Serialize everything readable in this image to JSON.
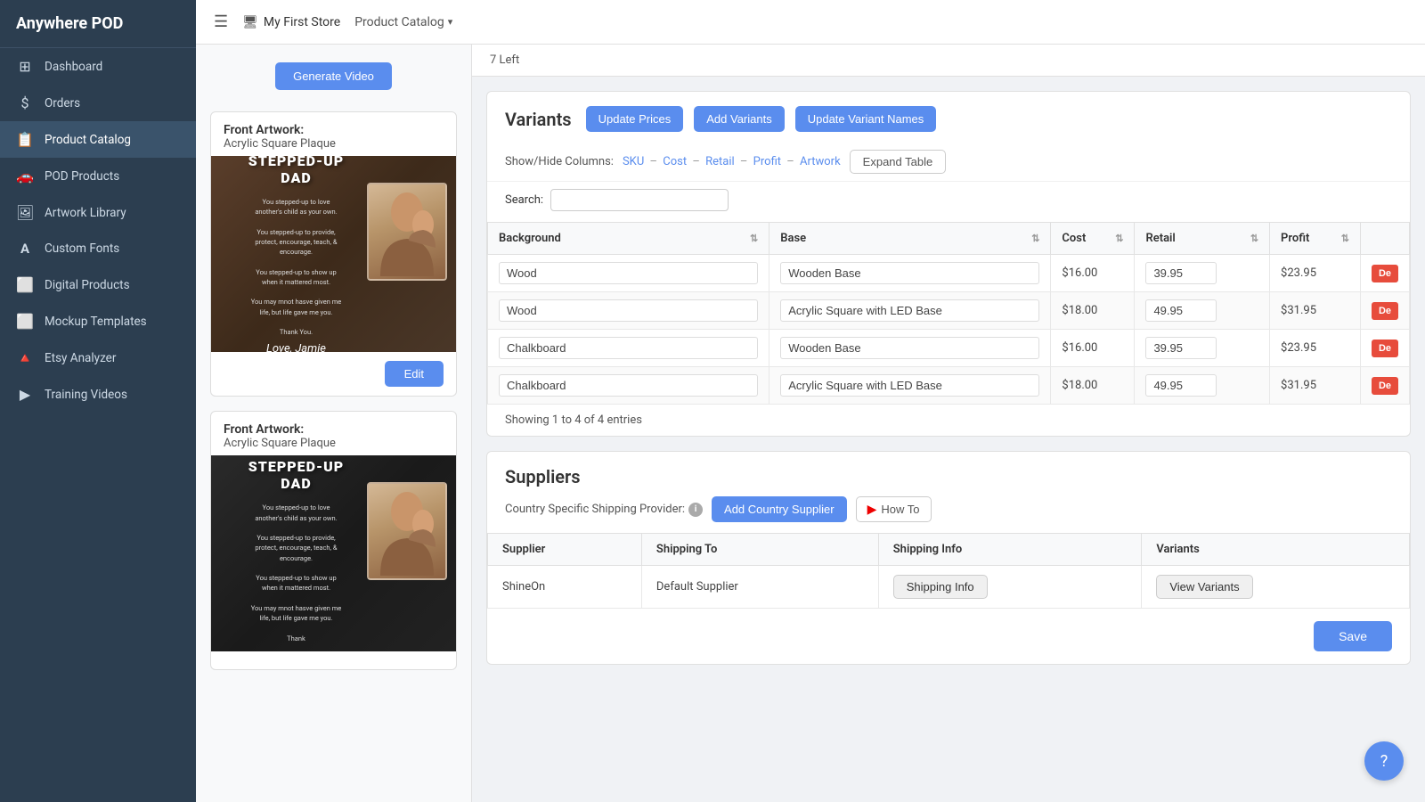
{
  "app": {
    "name": "Anywhere POD"
  },
  "topnav": {
    "store": "My First Store",
    "breadcrumb": "Product Catalog",
    "breadcrumb_caret": "▾"
  },
  "sidebar": {
    "items": [
      {
        "id": "dashboard",
        "label": "Dashboard",
        "icon": "⊞"
      },
      {
        "id": "orders",
        "label": "Orders",
        "icon": "$"
      },
      {
        "id": "product-catalog",
        "label": "Product Catalog",
        "icon": "📋",
        "active": true
      },
      {
        "id": "pod-products",
        "label": "POD Products",
        "icon": "🚗"
      },
      {
        "id": "artwork-library",
        "label": "Artwork Library",
        "icon": "🖼"
      },
      {
        "id": "custom-fonts",
        "label": "Custom Fonts",
        "icon": "A"
      },
      {
        "id": "digital-products",
        "label": "Digital Products",
        "icon": "⬜"
      },
      {
        "id": "mockup-templates",
        "label": "Mockup Templates",
        "icon": "⬜"
      },
      {
        "id": "etsy-analyzer",
        "label": "Etsy Analyzer",
        "icon": "🔺"
      },
      {
        "id": "training-videos",
        "label": "Training Videos",
        "icon": "▶"
      }
    ]
  },
  "left_panel": {
    "generate_btn": "Generate Video",
    "artworks": [
      {
        "id": "artwork-1",
        "title": "Front Artwork:",
        "subtitle": "Acrylic Square Plaque",
        "theme": "wood",
        "main_text": "STEPPED-UP DAD",
        "body_lines": [
          "You stepped-up to love another's",
          "child as your own.",
          "",
          "You stepped-up to provide, protect,",
          "encourage, teach, & encourage.",
          "",
          "You stepped-up to show up when it",
          "mattered most.",
          "",
          "You may mnot hasve given me life,",
          "but life gave me you.",
          "",
          "Thank You."
        ],
        "signature": "Love, Jamie",
        "edit_btn": "Edit"
      },
      {
        "id": "artwork-2",
        "title": "Front Artwork:",
        "subtitle": "Acrylic Square Plaque",
        "theme": "chalkboard",
        "main_text": "STEPPED-UP DAD",
        "body_lines": [
          "You stepped-up to love another's",
          "child as your own.",
          "",
          "You stepped-up to provide, protect,",
          "encourage, teach, & encourage.",
          "",
          "You stepped-up to show up when it",
          "mattered most.",
          "",
          "You may mnot hasve given me life,",
          "but life gave me you.",
          "",
          "Thank"
        ],
        "signature": "",
        "edit_btn": "Edit"
      }
    ]
  },
  "info_bar": {
    "left_text": "7 Left"
  },
  "variants": {
    "section_title": "Variants",
    "update_prices_btn": "Update Prices",
    "add_variants_btn": "Add Variants",
    "update_variant_names_btn": "Update Variant Names",
    "show_hide_label": "Show/Hide Columns:",
    "columns": [
      "SKU",
      "Cost",
      "Retail",
      "Profit",
      "Artwork"
    ],
    "separator": "–",
    "expand_table_btn": "Expand Table",
    "search_label": "Search:",
    "search_placeholder": "",
    "table_headers": [
      {
        "id": "background",
        "label": "Background",
        "sortable": true
      },
      {
        "id": "base",
        "label": "Base",
        "sortable": true
      },
      {
        "id": "cost",
        "label": "Cost",
        "sortable": true
      },
      {
        "id": "retail",
        "label": "Retail",
        "sortable": true
      },
      {
        "id": "profit",
        "label": "Profit",
        "sortable": true
      }
    ],
    "rows": [
      {
        "background": "Wood",
        "base": "Wooden Base",
        "cost": "$16.00",
        "retail": "39.95",
        "profit": "$23.95",
        "action": "De"
      },
      {
        "background": "Wood",
        "base": "Acrylic Square with LED Base",
        "cost": "$18.00",
        "retail": "49.95",
        "profit": "$31.95",
        "action": "De"
      },
      {
        "background": "Chalkboard",
        "base": "Wooden Base",
        "cost": "$16.00",
        "retail": "39.95",
        "profit": "$23.95",
        "action": "De"
      },
      {
        "background": "Chalkboard",
        "base": "Acrylic Square with LED Base",
        "cost": "$18.00",
        "retail": "49.95",
        "profit": "$31.95",
        "action": "De"
      }
    ],
    "showing_text": "Showing 1 to 4 of 4 entries"
  },
  "suppliers": {
    "section_title": "Suppliers",
    "country_label": "Country Specific Shipping Provider:",
    "add_country_btn": "Add Country Supplier",
    "how_to_btn": "How To",
    "table_headers": [
      "Supplier",
      "Shipping To",
      "Shipping Info",
      "Variants"
    ],
    "rows": [
      {
        "supplier": "ShineOn",
        "shipping_to": "Default Supplier",
        "shipping_info_btn": "Shipping Info",
        "variants_btn": "View Variants"
      }
    ]
  },
  "save": {
    "btn_label": "Save"
  },
  "help": {
    "icon": "?"
  }
}
